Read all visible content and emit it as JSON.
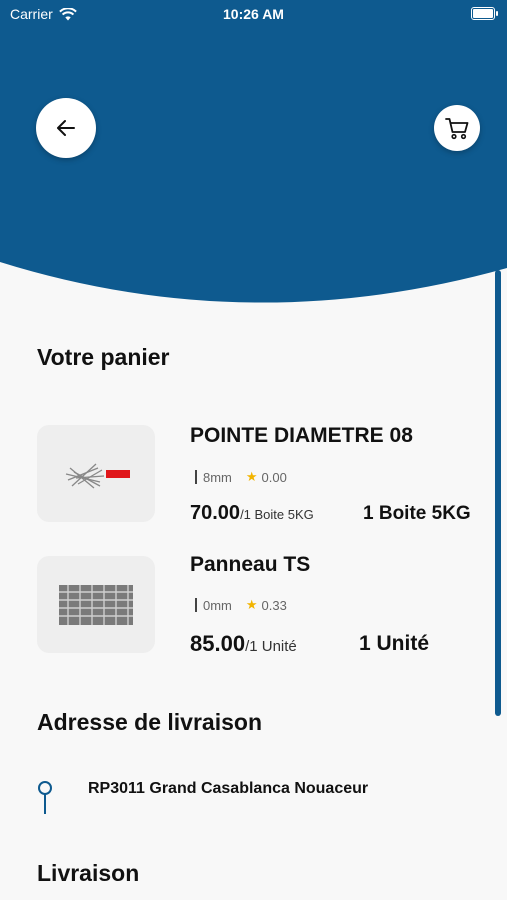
{
  "status_bar": {
    "carrier": "Carrier",
    "time": "10:26 AM"
  },
  "colors": {
    "header": "#0e5a8f",
    "star": "#f2b400",
    "background": "#f8f8f8"
  },
  "header": {
    "back_icon": "arrow-left-icon",
    "cart_icon": "cart-icon"
  },
  "cart": {
    "title": "Votre panier",
    "items": [
      {
        "name": "POINTE DIAMETRE 08",
        "spec": "8mm",
        "rating": "0.00",
        "price": "70.00",
        "price_unit": "/1 Boite 5KG",
        "quantity": "1 Boite 5KG"
      },
      {
        "name": "Panneau TS",
        "spec": "0mm",
        "rating": "0.33",
        "price": "85.00",
        "price_unit": "/1 Unité",
        "quantity": "1 Unité"
      }
    ]
  },
  "address": {
    "title": "Adresse de livraison",
    "line": "RP3011 Grand Casablanca Nouaceur",
    "icon": "location-pin-icon"
  },
  "delivery": {
    "title": "Livraison"
  }
}
